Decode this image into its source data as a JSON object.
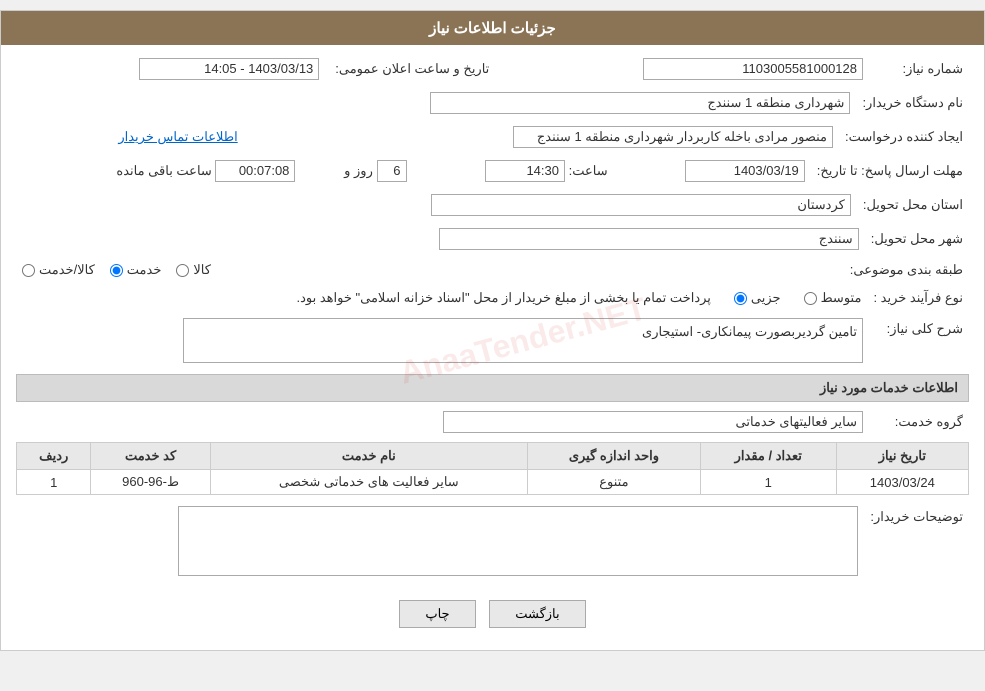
{
  "header": {
    "title": "جزئیات اطلاعات نیاز"
  },
  "fields": {
    "shomare_niaz_label": "شماره نیاز:",
    "shomare_niaz_value": "1103005581000128",
    "naam_dastgah_label": "نام دستگاه خریدار:",
    "naam_dastgah_value": "شهرداری منطقه 1 سنندج",
    "tarikh_saat_label": "تاریخ و ساعت اعلان عمومی:",
    "tarikh_saat_value": "1403/03/13 - 14:05",
    "ijad_konande_label": "ایجاد کننده درخواست:",
    "ijad_konande_value": "منصور مرادی باخله کاربردار شهرداری منطقه 1 سنندج",
    "ettela_tamas_label": "اطلاعات تماس خریدار",
    "mohlat_label": "مهلت ارسال پاسخ: تا تاریخ:",
    "mohlat_date": "1403/03/19",
    "mohlat_saat_label": "ساعت:",
    "mohlat_saat_value": "14:30",
    "mohlat_rooz_label": "روز و",
    "mohlat_rooz_value": "6",
    "mohlat_saat_mande_label": "ساعت باقی مانده",
    "mohlat_saat_mande_value": "00:07:08",
    "ostan_label": "استان محل تحویل:",
    "ostan_value": "کردستان",
    "shahr_label": "شهر محل تحویل:",
    "shahr_value": "سنندج",
    "tabaqe_label": "طبقه بندی موضوعی:",
    "tabaqe_kala": "کالا",
    "tabaqe_khadamat": "خدمت",
    "tabaqe_kala_khadamat": "کالا/خدمت",
    "tabaqe_selected": "khadamat",
    "novferayand_label": "نوع فرآیند خرید :",
    "novferayand_jozvi": "جزیی",
    "novferayand_motavaset": "متوسط",
    "novferayand_text": "پرداخت تمام یا بخشی از مبلغ خریدار از محل \"اسناد خزانه اسلامی\" خواهد بود.",
    "sharh_koli_label": "شرح کلی نیاز:",
    "sharh_koli_value": "تامین گردیربصورت پیمانکاری- استیجاری",
    "ettela_khadamat_label": "اطلاعات خدمات مورد نیاز",
    "gorohe_khadamat_label": "گروه خدمت:",
    "gorohe_khadamat_value": "سایر فعالیتهای خدماتی",
    "table": {
      "col_radif": "ردیف",
      "col_kod": "کد خدمت",
      "col_naam": "نام خدمت",
      "col_vahed": "واحد اندازه گیری",
      "col_tedad": "تعداد / مقدار",
      "col_tarikh": "تاریخ نیاز",
      "rows": [
        {
          "radif": "1",
          "kod": "ط-96-960",
          "naam": "سایر فعالیت های خدماتی شخصی",
          "vahed": "متنوع",
          "tedad": "1",
          "tarikh": "1403/03/24"
        }
      ]
    },
    "tawsif_label": "توضیحات خریدار:",
    "tawsif_value": "",
    "btn_chap": "چاپ",
    "btn_bazgasht": "بازگشت"
  }
}
